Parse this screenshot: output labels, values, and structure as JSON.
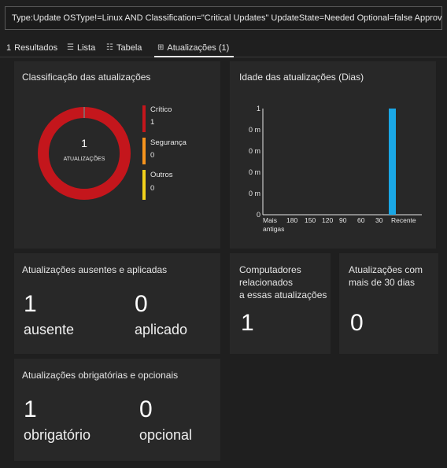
{
  "query": "Type:Update OSType!=Linux AND Classification=\"Critical Updates\" UpdateState=Needed Optional=false Approved!=false",
  "tabs": {
    "results_count": "1",
    "results_label": "Resultados",
    "list_label": "Lista",
    "table_label": "Tabela",
    "updates_label": "Atualizações (1)"
  },
  "classification": {
    "title": "Classificação das atualizações",
    "center_value": "1",
    "center_label": "ATUALIZAÇÕES",
    "legend": [
      {
        "name": "Crítico",
        "value": "1",
        "color": "#c4161c"
      },
      {
        "name": "Segurança",
        "value": "0",
        "color": "#f7941d"
      },
      {
        "name": "Outros",
        "value": "0",
        "color": "#f3d21b"
      }
    ]
  },
  "age": {
    "title": "Idade das atualizações (Dias)",
    "chart_data": {
      "type": "bar",
      "categories": [
        "Mais antigas",
        "180",
        "150",
        "120",
        "90",
        "60",
        "30",
        "Recente"
      ],
      "values": [
        0,
        0,
        0,
        0,
        0,
        0,
        0,
        1
      ],
      "ytick_labels": [
        "0",
        "0 m",
        "0 m",
        "0 m",
        "0 m",
        "1"
      ],
      "ylim": [
        0,
        1
      ],
      "bar_color": "#1aa7e6"
    }
  },
  "missing_applied": {
    "title": "Atualizações ausentes e aplicadas",
    "missing_value": "1",
    "missing_label": "ausente",
    "applied_value": "0",
    "applied_label": "aplicado"
  },
  "computers": {
    "title_line1": "Computadores",
    "title_line2": "relacionados",
    "title_line3": "a essas atualizações",
    "value": "1"
  },
  "older30": {
    "title_line1": "Atualizações com",
    "title_line2": "mais de 30 dias",
    "value": "0"
  },
  "required_optional": {
    "title": "Atualizações obrigatórias e opcionais",
    "required_value": "1",
    "required_label": "obrigatório",
    "optional_value": "0",
    "optional_label": "opcional"
  }
}
